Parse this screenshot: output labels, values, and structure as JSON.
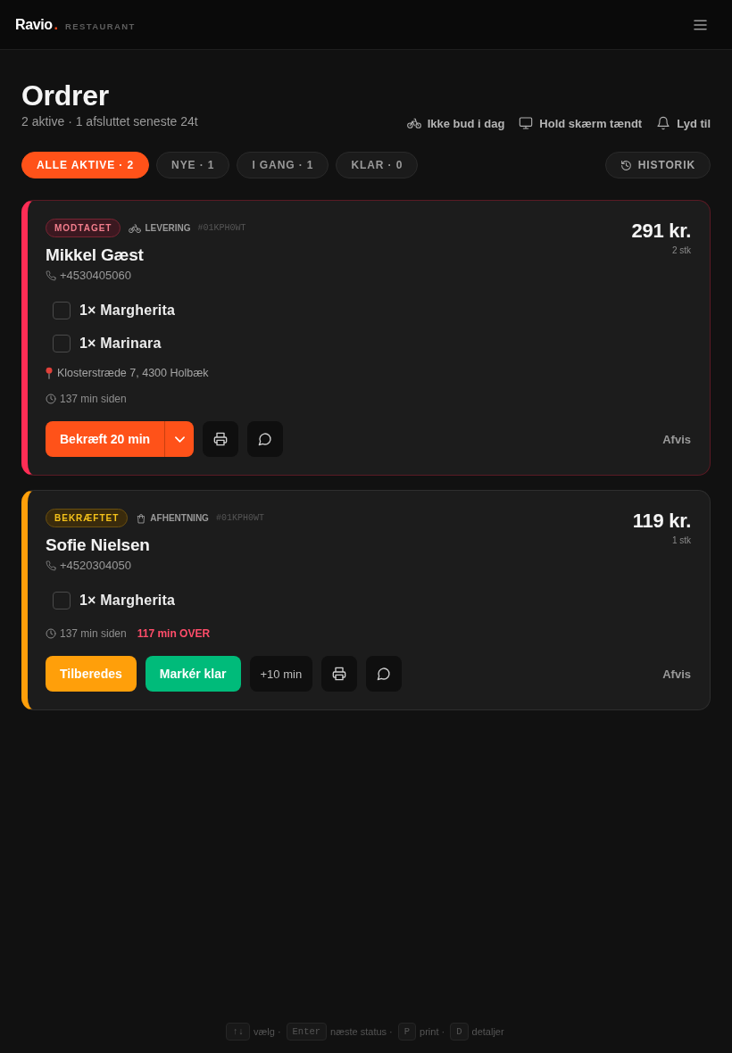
{
  "header": {
    "brand": "Ravio",
    "brand_dot": ".",
    "section": "RESTAURANT"
  },
  "page": {
    "title": "Ordrer",
    "subtitle": "2 aktive · 1 afsluttet seneste 24t"
  },
  "toggles": [
    {
      "kind": "bike",
      "label": "Ikke bud i dag"
    },
    {
      "kind": "screen",
      "label": "Hold skærm tændt"
    },
    {
      "kind": "sound",
      "label": "Lyd til"
    }
  ],
  "filters": [
    {
      "label": "ALLE AKTIVE · 2",
      "selected": true
    },
    {
      "label": "NYE · 1",
      "selected": false
    },
    {
      "label": "I GANG · 1",
      "selected": false
    },
    {
      "label": "KLAR · 0",
      "selected": false
    }
  ],
  "history_button": {
    "label": "HISTORIK"
  },
  "orders": [
    {
      "status": {
        "label": "MODTAGET",
        "kind": "received"
      },
      "method": {
        "label": "LEVERING",
        "kind": "delivery"
      },
      "order_id": "#01KPH0WT",
      "customer": "Mikkel Gæst",
      "phone": "+4530405060",
      "total": "291 kr.",
      "quantity": "2 stk",
      "items": [
        {
          "label": "1× Margherita",
          "checked": false
        },
        {
          "label": "1× Marinara",
          "checked": false
        }
      ],
      "address": "Klosterstræde 7, 4300 Holbæk",
      "age": "137 min siden",
      "actions": [
        {
          "kind": "split",
          "label": "Bekræft 20 min"
        },
        {
          "kind": "print"
        },
        {
          "kind": "chat"
        }
      ],
      "reject": "Afvis"
    },
    {
      "status": {
        "label": "BEKRÆFTET",
        "kind": "confirmed"
      },
      "method": {
        "label": "AFHENTNING",
        "kind": "pickup"
      },
      "order_id": "#01KPH0WT",
      "customer": "Sofie Nielsen",
      "phone": "+4520304050",
      "total": "119 kr.",
      "quantity": "1 stk",
      "items": [
        {
          "label": "1× Margherita",
          "checked": false
        }
      ],
      "age": "137 min siden",
      "overdue": "117 min OVER",
      "actions": [
        {
          "kind": "warning",
          "label": "Tilberedes"
        },
        {
          "kind": "success",
          "label": "Markér klar"
        },
        {
          "kind": "plain",
          "label": "+10 min"
        },
        {
          "kind": "print"
        },
        {
          "kind": "chat"
        }
      ],
      "reject": "Afvis"
    }
  ],
  "shortcuts": [
    {
      "key": "↑↓",
      "label": "vælg ·"
    },
    {
      "key": "Enter",
      "label": "næste status ·"
    },
    {
      "key": "P",
      "label": "print ·"
    },
    {
      "key": "D",
      "label": "detaljer"
    }
  ]
}
